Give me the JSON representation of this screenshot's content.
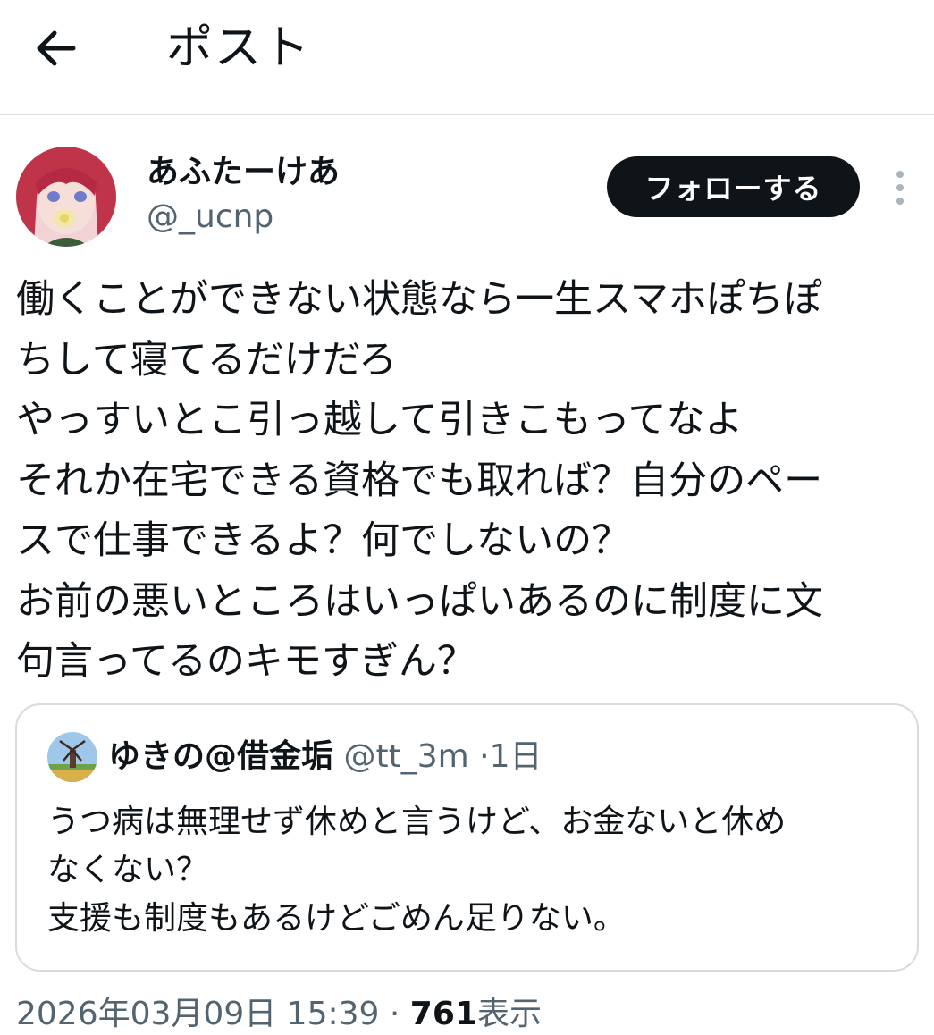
{
  "header": {
    "title": "ポスト",
    "back_icon": "arrow-left-icon"
  },
  "post": {
    "author": {
      "display_name": "あふたーけあ",
      "handle": "@_ucnp"
    },
    "follow_label": "フォローする",
    "more_icon": "vertical-ellipsis-icon",
    "text_lines": [
      "働くことができない状態なら一生スマホぽちぽ",
      "ちして寝てるだけだろ",
      "やっすいとこ引っ越して引きこもってなよ",
      "それか在宅できる資格でも取れば？自分のペー",
      "スで仕事できるよ？何でしないの？",
      "お前の悪いところはいっぱいあるのに制度に文",
      "句言ってるのキモすぎん？"
    ]
  },
  "quote": {
    "author": {
      "display_name": "ゆきの@借金垢",
      "handle": "@tt_3m"
    },
    "separator": "·",
    "time": "1日",
    "text_lines": [
      "うつ病は無理せず休めと言うけど、お金ないと休め",
      "なくない？",
      "支援も制度もあるけどごめん足りない。"
    ]
  },
  "meta": {
    "datetime": "2026年03月09日 15:39",
    "separator": "·",
    "views": "761",
    "views_label": "表示"
  },
  "colors": {
    "text": "#0f1419",
    "secondary": "#536471",
    "border": "#d5dbdf",
    "button_bg": "#0f1419"
  }
}
